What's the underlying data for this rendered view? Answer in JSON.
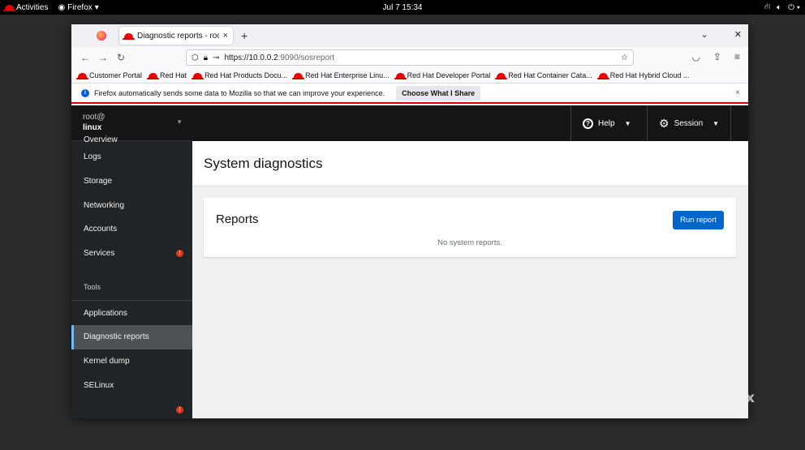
{
  "topbar": {
    "activities": "Activities",
    "app_menu": "Firefox",
    "clock": "Jul 7  15:34"
  },
  "browser": {
    "tab": {
      "title": "Diagnostic reports - root@",
      "close": "×"
    },
    "new_tab": "+",
    "url": {
      "host": "https://10.0.0.2",
      "path": ":9090/sosreport"
    },
    "bookmarks": [
      "Customer Portal",
      "Red Hat",
      "Red Hat Products Docu...",
      "Red Hat Enterprise Linu...",
      "Red Hat Developer Portal",
      "Red Hat Container Cata...",
      "Red Hat Hybrid Cloud ..."
    ],
    "notification": {
      "text": "Firefox automatically sends some data to Mozilla so that we can improve your experience.",
      "button": "Choose What I Share",
      "close": "×"
    }
  },
  "cockpit": {
    "host": {
      "user": "root@",
      "name": "linux"
    },
    "nav": {
      "overview": "Overview",
      "logs": "Logs",
      "storage": "Storage",
      "networking": "Networking",
      "accounts": "Accounts",
      "services": "Services",
      "services_badge": "!",
      "tools_header": "Tools",
      "applications": "Applications",
      "diagnostic_reports": "Diagnostic reports",
      "kernel_dump": "Kernel dump",
      "selinux": "SELinux",
      "software_updates_badge": "!"
    },
    "masthead": {
      "help": "Help",
      "session": "Session"
    },
    "page_title": "System diagnostics",
    "reports": {
      "title": "Reports",
      "run_button": "Run report",
      "empty": "No system reports."
    }
  },
  "desktop_text": "x",
  "colors": {
    "accent": "#0066cc",
    "sidebar": "#212427",
    "masthead": "#151515",
    "active_bar": "#73bcf7",
    "badge": "#e0371f"
  }
}
